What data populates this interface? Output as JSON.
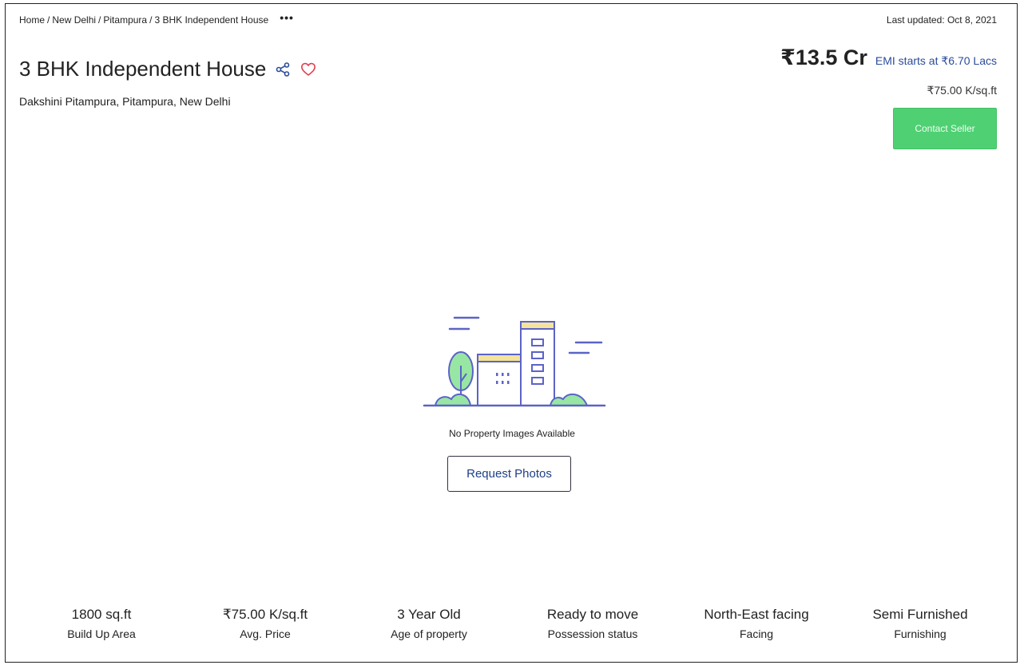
{
  "breadcrumb": {
    "items": [
      "Home",
      "New Delhi",
      "Pitampura",
      "3 BHK Independent House"
    ],
    "more": "•••"
  },
  "last_updated": "Last updated: Oct 8, 2021",
  "listing": {
    "title": "3 BHK Independent House",
    "address": "Dakshini Pitampura, Pitampura, New Delhi",
    "price": "₹13.5 Cr",
    "emi": "EMI starts at ₹6.70 Lacs",
    "price_per_sqft": "₹75.00 K/sq.ft",
    "contact_label": "Contact Seller",
    "icons": [
      "share-icon",
      "heart-icon"
    ]
  },
  "media": {
    "empty_text": "No Property Images Available",
    "request_label": "Request Photos"
  },
  "stats": [
    {
      "value": "1800 sq.ft",
      "label": "Build Up Area"
    },
    {
      "value": "₹75.00 K/sq.ft",
      "label": "Avg. Price"
    },
    {
      "value": "3 Year Old",
      "label": "Age of property"
    },
    {
      "value": "Ready to move",
      "label": "Possession status"
    },
    {
      "value": "North-East facing",
      "label": "Facing"
    },
    {
      "value": "Semi Furnished",
      "label": "Furnishing"
    }
  ],
  "colors": {
    "accent_green": "#4fd073",
    "link_blue": "#2b4c9b",
    "heart_red": "#e0414f",
    "illustration_line": "#5c63c7",
    "illustration_green": "#98e6a4",
    "illustration_yellow": "#f4e39a"
  }
}
